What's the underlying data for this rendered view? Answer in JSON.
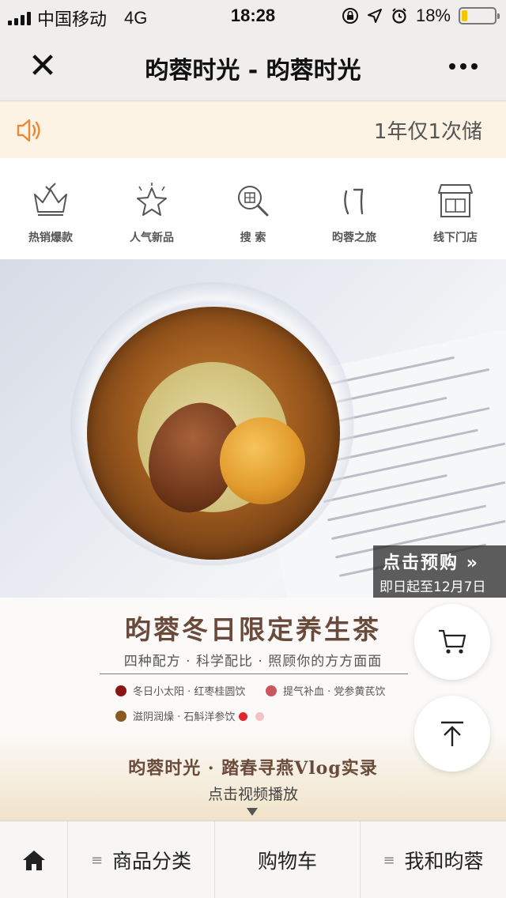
{
  "status_bar": {
    "carrier": "中国移动",
    "network": "4G",
    "time": "18:28",
    "battery": "18%",
    "battery_level": 0.18
  },
  "header": {
    "title": "昀蓉时光 - 昀蓉时光",
    "close_icon": "close-icon",
    "more_icon": "more-icon"
  },
  "notice": {
    "text": "1年仅1次储"
  },
  "icon_nav": [
    {
      "label": "热销爆款",
      "icon": "crown-icon"
    },
    {
      "label": "人气新品",
      "icon": "star-icon"
    },
    {
      "label": "搜 索",
      "icon": "search-icon"
    },
    {
      "label": "昀蓉之旅",
      "icon": "brand-logo-icon"
    },
    {
      "label": "线下门店",
      "icon": "store-icon"
    }
  ],
  "hero": {
    "cta_main": "点击预购",
    "cta_sub": "即日起至12月7日"
  },
  "promo": {
    "title": "昀蓉冬日限定养生茶",
    "subtitle": "四种配方 · 科学配比 · 照顾你的方方面面",
    "recipes": [
      {
        "text": "冬日小太阳 · 红枣桂圆饮",
        "color": "#8b1515"
      },
      {
        "text": "提气补血 · 党参黄芪饮",
        "color": "#c9575c"
      },
      {
        "text": "滋阴润燥 · 石斛洋参饮",
        "color": "#8a5a22"
      }
    ],
    "pager_colors": [
      "#e0262c",
      "#f2c3c5"
    ],
    "vlog_title": "昀蓉时光 · 踏春寻燕Vlog实录",
    "vlog_sub": "点击视频播放"
  },
  "floating": {
    "cart_icon": "cart-icon",
    "top_icon": "back-to-top-icon"
  },
  "tabbar": {
    "home_icon": "home-icon",
    "category": "商品分类",
    "cart": "购物车",
    "me": "我和昀蓉"
  },
  "colors": {
    "accent": "#e0262c",
    "notice_bg": "#fdf3e4",
    "speaker": "#e8893a",
    "battery_fill": "#f5c500"
  }
}
